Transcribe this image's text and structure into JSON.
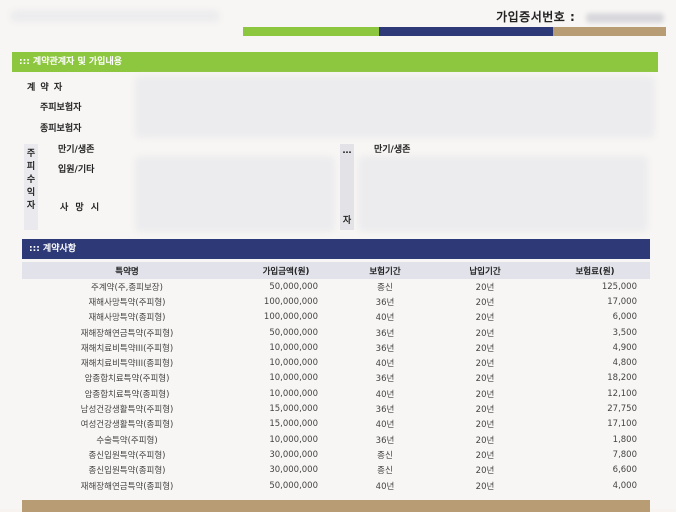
{
  "header": {
    "contract_no_label": "가입증서번호 :"
  },
  "section1": {
    "title": "::: 계약관계자 및 가입내용",
    "labels": {
      "contractor": "계 약 자",
      "main_insured": "주피보험자",
      "sub_insured": "종피보험자",
      "maturity_survival": "만기/생존",
      "hospital_other": "입원/기타",
      "death": "사 망 시",
      "maturity_survival_right": "만기/생존"
    },
    "beneficiary_vertical": [
      "주",
      "피",
      "수",
      "익",
      "자"
    ],
    "small_col_bottom": "자"
  },
  "section2": {
    "title": "::: 계약사항",
    "columns": [
      "특약명",
      "가입금액(원)",
      "보험기간",
      "납입기간",
      "보험료(원)"
    ],
    "rows": [
      [
        "주계약(주,종피보장)",
        "50,000,000",
        "종신",
        "20년",
        "125,000"
      ],
      [
        "재해사망특약(주피형)",
        "100,000,000",
        "36년",
        "20년",
        "17,000"
      ],
      [
        "재해사망특약(종피형)",
        "100,000,000",
        "40년",
        "20년",
        "6,000"
      ],
      [
        "재해장해연금특약(주피형)",
        "50,000,000",
        "36년",
        "20년",
        "3,500"
      ],
      [
        "재해치료비특약III(주피형)",
        "10,000,000",
        "36년",
        "20년",
        "4,900"
      ],
      [
        "재해치료비특약III(종피형)",
        "10,000,000",
        "40년",
        "20년",
        "4,800"
      ],
      [
        "암종합치료특약(주피형)",
        "10,000,000",
        "36년",
        "20년",
        "18,200"
      ],
      [
        "암종합치료특약(종피형)",
        "10,000,000",
        "40년",
        "20년",
        "12,100"
      ],
      [
        "남성건강생활특약(주피형)",
        "15,000,000",
        "36년",
        "20년",
        "27,750"
      ],
      [
        "여성건강생활특약(종피형)",
        "15,000,000",
        "40년",
        "20년",
        "17,100"
      ],
      [
        "수술특약(주피형)",
        "10,000,000",
        "36년",
        "20년",
        "1,800"
      ],
      [
        "종신입원특약(주피형)",
        "30,000,000",
        "종신",
        "20년",
        "7,800"
      ],
      [
        "종신입원특약(종피형)",
        "30,000,000",
        "종신",
        "20년",
        "6,600"
      ],
      [
        "재해장해연금특약(종피형)",
        "50,000,000",
        "40년",
        "20년",
        "4,000"
      ]
    ]
  },
  "colors": {
    "green": "#8dc63f",
    "navy": "#2e3a78",
    "tan": "#b89c74"
  }
}
